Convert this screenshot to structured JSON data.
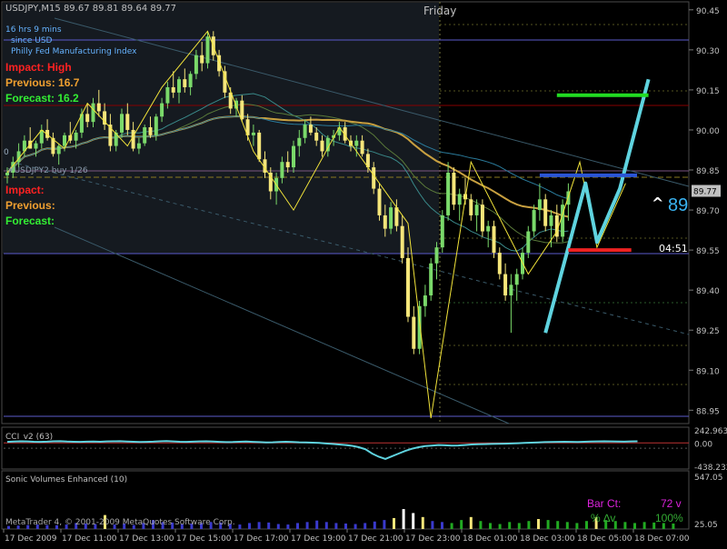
{
  "colors": {
    "background": "#000000",
    "panel_border": "#4a4a4a",
    "grid": "#333333",
    "bull_candle": "#7ad96a",
    "bear_candle": "#f5e67a",
    "zigzag": "#f2e43a",
    "cyan_wave": "#5fd3df",
    "green_level": "#22dd22",
    "blue_level": "#2a55d6",
    "red_level": "#ee2222",
    "cci_line": "#5fd3df",
    "impact_red": "#ff2222",
    "previous_orange": "#f0a030",
    "forecast_green": "#33ee33",
    "info_blue": "#66b3ff",
    "axis_text": "#c0c0c0"
  },
  "header": {
    "symbol_quote": "USDJPY,M15  89.67 89.81 89.64 89.77",
    "day_label": "Friday"
  },
  "news_block": {
    "countdown": "16 hrs 9 mins",
    "since": "since USD",
    "event": "Philly Fed Manufacturing Index",
    "impact": "Impact: High",
    "previous": "Previous: 16.7",
    "forecast": "Forecast: 16.2",
    "impact_blank": "Impact:",
    "previous_blank": "Previous:",
    "forecast_blank": "Forecast:",
    "partial_label_1": "0",
    "partial_label_2": "#USDJPY2 buy 1/26"
  },
  "overlays": {
    "arrow_label": "^",
    "arrow_value": "89",
    "timer": "04:51",
    "current_price_tag": "89.77"
  },
  "chart_data": [
    {
      "type": "candlestick",
      "title": "USDJPY,M15",
      "ylim": [
        88.9,
        90.48
      ],
      "y_ticks": [
        "90.45",
        "90.30",
        "90.15",
        "90.00",
        "89.85",
        "89.70",
        "89.55",
        "89.40",
        "89.25",
        "89.10",
        "88.95"
      ],
      "current_price": 89.77,
      "x_tick_labels": [
        "17 Dec 2009",
        "17 Dec 11:00",
        "17 Dec 13:00",
        "17 Dec 15:00",
        "17 Dec 17:00",
        "17 Dec 19:00",
        "17 Dec 21:00",
        "17 Dec 23:00",
        "18 Dec 01:00",
        "18 Dec 03:00",
        "18 Dec 05:00",
        "18 Dec 07:00"
      ],
      "candles": [
        [
          89.83,
          89.86,
          89.8,
          89.84
        ],
        [
          89.84,
          89.9,
          89.82,
          89.88
        ],
        [
          89.88,
          89.95,
          89.86,
          89.92
        ],
        [
          89.92,
          89.98,
          89.9,
          89.96
        ],
        [
          89.96,
          90.01,
          89.93,
          89.93
        ],
        [
          89.93,
          89.96,
          89.9,
          89.95
        ],
        [
          89.95,
          90.02,
          89.93,
          90.0
        ],
        [
          90.0,
          90.04,
          89.96,
          89.97
        ],
        [
          89.97,
          89.99,
          89.9,
          89.91
        ],
        [
          89.91,
          89.95,
          89.87,
          89.94
        ],
        [
          89.94,
          89.99,
          89.92,
          89.98
        ],
        [
          89.98,
          90.03,
          89.95,
          89.96
        ],
        [
          89.96,
          90.0,
          89.93,
          89.99
        ],
        [
          89.99,
          90.08,
          89.97,
          90.06
        ],
        [
          90.06,
          90.1,
          90.01,
          90.03
        ],
        [
          90.03,
          90.12,
          90.01,
          90.1
        ],
        [
          90.1,
          90.15,
          90.05,
          90.07
        ],
        [
          90.07,
          90.1,
          90.0,
          90.02
        ],
        [
          90.02,
          90.06,
          89.92,
          89.94
        ],
        [
          89.94,
          90.0,
          89.92,
          89.99
        ],
        [
          89.99,
          90.08,
          89.97,
          90.06
        ],
        [
          90.06,
          90.1,
          89.98,
          90.0
        ],
        [
          90.0,
          90.03,
          89.92,
          89.93
        ],
        [
          89.93,
          89.97,
          89.91,
          89.95
        ],
        [
          89.95,
          90.02,
          89.94,
          90.01
        ],
        [
          90.01,
          90.05,
          89.97,
          89.98
        ],
        [
          89.98,
          90.06,
          89.96,
          90.05
        ],
        [
          90.05,
          90.12,
          90.03,
          90.1
        ],
        [
          90.1,
          90.18,
          90.08,
          90.16
        ],
        [
          90.16,
          90.22,
          90.12,
          90.14
        ],
        [
          90.14,
          90.2,
          90.1,
          90.19
        ],
        [
          90.19,
          90.23,
          90.14,
          90.16
        ],
        [
          90.16,
          90.22,
          90.13,
          90.21
        ],
        [
          90.21,
          90.3,
          90.19,
          90.28
        ],
        [
          90.28,
          90.33,
          90.22,
          90.25
        ],
        [
          90.25,
          90.37,
          90.23,
          90.35
        ],
        [
          90.35,
          90.37,
          90.26,
          90.28
        ],
        [
          90.28,
          90.3,
          90.2,
          90.22
        ],
        [
          90.22,
          90.24,
          90.12,
          90.14
        ],
        [
          90.14,
          90.16,
          90.06,
          90.08
        ],
        [
          90.08,
          90.12,
          90.05,
          90.11
        ],
        [
          90.11,
          90.13,
          90.03,
          90.04
        ],
        [
          90.04,
          90.06,
          89.96,
          89.98
        ],
        [
          89.98,
          90.02,
          89.94,
          89.99
        ],
        [
          89.99,
          90.0,
          89.88,
          89.89
        ],
        [
          89.89,
          89.92,
          89.82,
          89.84
        ],
        [
          89.84,
          89.86,
          89.74,
          89.77
        ],
        [
          89.77,
          89.84,
          89.72,
          89.82
        ],
        [
          89.82,
          89.9,
          89.8,
          89.88
        ],
        [
          89.88,
          89.92,
          89.84,
          89.86
        ],
        [
          89.86,
          89.96,
          89.84,
          89.94
        ],
        [
          89.94,
          90.0,
          89.9,
          89.97
        ],
        [
          89.97,
          90.04,
          89.95,
          90.02
        ],
        [
          90.02,
          90.05,
          89.98,
          89.99
        ],
        [
          89.99,
          90.01,
          89.94,
          89.96
        ],
        [
          89.96,
          89.98,
          89.9,
          89.92
        ],
        [
          89.92,
          89.98,
          89.9,
          89.97
        ],
        [
          89.97,
          90.0,
          89.94,
          89.98
        ],
        [
          89.98,
          90.03,
          89.96,
          90.01
        ],
        [
          90.01,
          90.03,
          89.95,
          89.96
        ],
        [
          89.96,
          89.98,
          89.92,
          89.94
        ],
        [
          89.94,
          89.98,
          89.9,
          89.96
        ],
        [
          89.96,
          89.98,
          89.9,
          89.91
        ],
        [
          89.91,
          89.93,
          89.84,
          89.86
        ],
        [
          89.86,
          89.88,
          89.76,
          89.78
        ],
        [
          89.78,
          89.8,
          89.66,
          89.68
        ],
        [
          89.68,
          89.72,
          89.6,
          89.63
        ],
        [
          89.63,
          89.73,
          89.61,
          89.71
        ],
        [
          89.71,
          89.74,
          89.62,
          89.64
        ],
        [
          89.64,
          89.68,
          89.5,
          89.52
        ],
        [
          89.52,
          89.56,
          89.28,
          89.3
        ],
        [
          89.3,
          89.34,
          89.16,
          89.18
        ],
        [
          89.18,
          89.36,
          89.16,
          89.34
        ],
        [
          89.34,
          89.42,
          89.3,
          89.38
        ],
        [
          89.38,
          89.52,
          89.36,
          89.5
        ],
        [
          89.5,
          89.58,
          89.44,
          89.56
        ],
        [
          89.56,
          89.7,
          89.54,
          89.68
        ],
        [
          89.68,
          89.88,
          89.66,
          89.84
        ],
        [
          89.84,
          89.86,
          89.7,
          89.72
        ],
        [
          89.72,
          89.78,
          89.66,
          89.76
        ],
        [
          89.76,
          89.82,
          89.72,
          89.74
        ],
        [
          89.74,
          89.76,
          89.66,
          89.68
        ],
        [
          89.68,
          89.74,
          89.62,
          89.72
        ],
        [
          89.72,
          89.74,
          89.6,
          89.62
        ],
        [
          89.62,
          89.66,
          89.56,
          89.64
        ],
        [
          89.64,
          89.66,
          89.52,
          89.54
        ],
        [
          89.54,
          89.56,
          89.44,
          89.46
        ],
        [
          89.46,
          89.5,
          89.36,
          89.38
        ],
        [
          89.38,
          89.46,
          89.24,
          89.42
        ],
        [
          89.42,
          89.48,
          89.36,
          89.46
        ],
        [
          89.46,
          89.56,
          89.44,
          89.54
        ],
        [
          89.54,
          89.64,
          89.52,
          89.62
        ],
        [
          89.62,
          89.72,
          89.6,
          89.7
        ],
        [
          89.7,
          89.8,
          89.66,
          89.74
        ],
        [
          89.74,
          89.76,
          89.62,
          89.64
        ],
        [
          89.64,
          89.7,
          89.56,
          89.68
        ],
        [
          89.68,
          89.72,
          89.58,
          89.6
        ],
        [
          89.6,
          89.74,
          89.58,
          89.72
        ],
        [
          89.72,
          89.8,
          89.66,
          89.77
        ]
      ],
      "zigzag": [
        [
          0,
          89.84
        ],
        [
          6,
          90.0
        ],
        [
          10,
          89.93
        ],
        [
          14,
          90.1
        ],
        [
          21,
          89.94
        ],
        [
          27,
          90.16
        ],
        [
          35,
          90.37
        ],
        [
          43,
          89.92
        ],
        [
          50,
          89.7
        ],
        [
          58,
          90.01
        ],
        [
          70,
          89.65
        ],
        [
          74,
          88.92
        ],
        [
          81,
          89.88
        ],
        [
          91,
          89.46
        ],
        [
          96,
          89.62
        ],
        [
          100,
          89.88
        ],
        [
          103,
          89.56
        ],
        [
          108,
          89.8
        ]
      ],
      "cyan_wave": [
        [
          94,
          89.24
        ],
        [
          101,
          89.8
        ],
        [
          103,
          89.58
        ],
        [
          107,
          89.78
        ],
        [
          112,
          90.19
        ]
      ],
      "levels": [
        {
          "price": 90.13,
          "color": "green_level",
          "from": 96,
          "to": 112
        },
        {
          "price": 89.83,
          "color": "blue_level",
          "from": 93,
          "to": 110
        },
        {
          "price": 89.55,
          "color": "red_level",
          "from": 98,
          "to": 109
        }
      ]
    },
    {
      "type": "line",
      "title": "CCI_v2 (63)",
      "ylim": [
        -438.232,
        242.9634
      ],
      "y_ticks": [
        "242.9634",
        "0.00",
        "-438.232"
      ],
      "values": [
        20,
        25,
        30,
        28,
        22,
        20,
        24,
        30,
        32,
        25,
        22,
        20,
        24,
        26,
        22,
        28,
        30,
        32,
        26,
        22,
        18,
        20,
        24,
        30,
        34,
        28,
        22,
        20,
        24,
        28,
        30,
        26,
        20,
        14,
        16,
        22,
        26,
        20,
        14,
        10,
        12,
        18,
        22,
        18,
        12,
        8,
        4,
        0,
        -10,
        -20,
        -30,
        -40,
        -55,
        -80,
        -120,
        -200,
        -260,
        -300,
        -250,
        -200,
        -150,
        -110,
        -80,
        -60,
        -50,
        -40,
        -45,
        -50,
        -48,
        -40,
        -30,
        -25,
        -22,
        -20,
        -18,
        -14,
        -10,
        -6,
        0,
        5,
        10,
        14,
        18,
        20,
        22,
        20,
        18,
        22,
        26,
        28,
        30,
        28,
        26,
        24,
        28,
        30
      ]
    },
    {
      "type": "bar",
      "title": "Sonic Volumes Enhanced  (10)",
      "ylim": [
        0,
        547.05
      ],
      "y_ticks": [
        "547.05",
        "25.05"
      ],
      "values": [
        30,
        35,
        40,
        45,
        40,
        38,
        45,
        60,
        55,
        50,
        140,
        45,
        55,
        40,
        60,
        90,
        70,
        65,
        50,
        55,
        60,
        70,
        65,
        50,
        45,
        60,
        70,
        65,
        50,
        45,
        60,
        70,
        85,
        70,
        60,
        55,
        50,
        60,
        75,
        90,
        110,
        200,
        160,
        120,
        80,
        70,
        60,
        90,
        120,
        80,
        60,
        50,
        70,
        60,
        80,
        100,
        90,
        80,
        70,
        60,
        80,
        120,
        90,
        80,
        70,
        60,
        70,
        65,
        60,
        55
      ],
      "labels": {
        "bar_count_label": "Bar Ct:",
        "bar_count_value": "72 v",
        "percent_label": "% ∆v",
        "percent_value": "100%",
        "copyright": "MetaTrader 4, © 2001-2009 MetaQuotes Software Corp."
      }
    }
  ]
}
